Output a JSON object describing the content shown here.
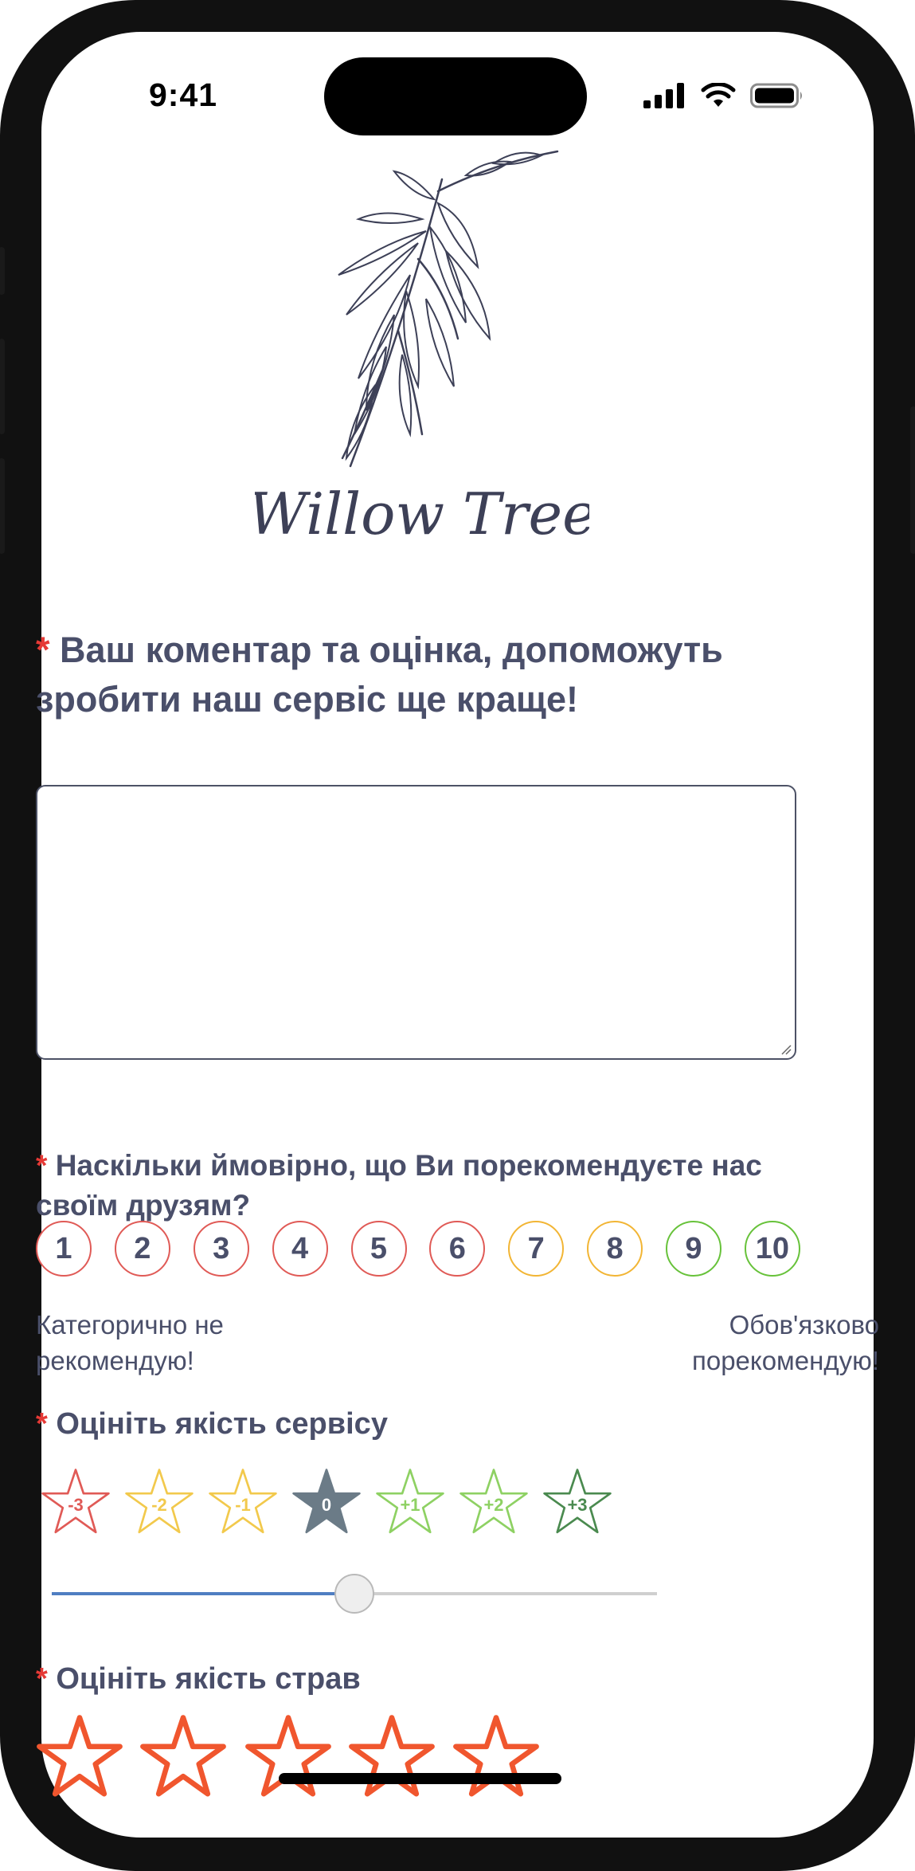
{
  "status_bar": {
    "time": "9:41"
  },
  "brand": {
    "name": "Willow Tree"
  },
  "comment_question": {
    "required_mark": "*",
    "text": "Ваш коментар та оцінка, допоможуть зробити наш сервіс ще краще!",
    "value": ""
  },
  "recommend_question": {
    "required_mark": "*",
    "text": "Наскільки ймовірно, що Ви порекомендуєте нас своїм друзям?",
    "options": [
      "1",
      "2",
      "3",
      "4",
      "5",
      "6",
      "7",
      "8",
      "9",
      "10"
    ],
    "low_label": "Категорично не рекомендую!",
    "high_label": "Обов'язково порекомендую!"
  },
  "service_question": {
    "required_mark": "*",
    "text": "Оцініть якість сервісу",
    "options": [
      "-3",
      "-2",
      "-1",
      "0",
      "+1",
      "+2",
      "+3"
    ],
    "selected": "0",
    "slider_fraction": 0.5
  },
  "food_question": {
    "required_mark": "*",
    "text": "Оцініть якість страв",
    "stars": 5,
    "selected": 0
  },
  "colors": {
    "text": "#4a4f6a",
    "required": "#e53935",
    "red": "#e05a56",
    "amber": "#f2b534",
    "green": "#67c23a",
    "dark_green": "#4a8a4f",
    "selected_star": "#6b7b87",
    "food_star": "#f0562e",
    "slider_fill": "#4f7ec2",
    "slider_track": "#cfcfcf"
  }
}
